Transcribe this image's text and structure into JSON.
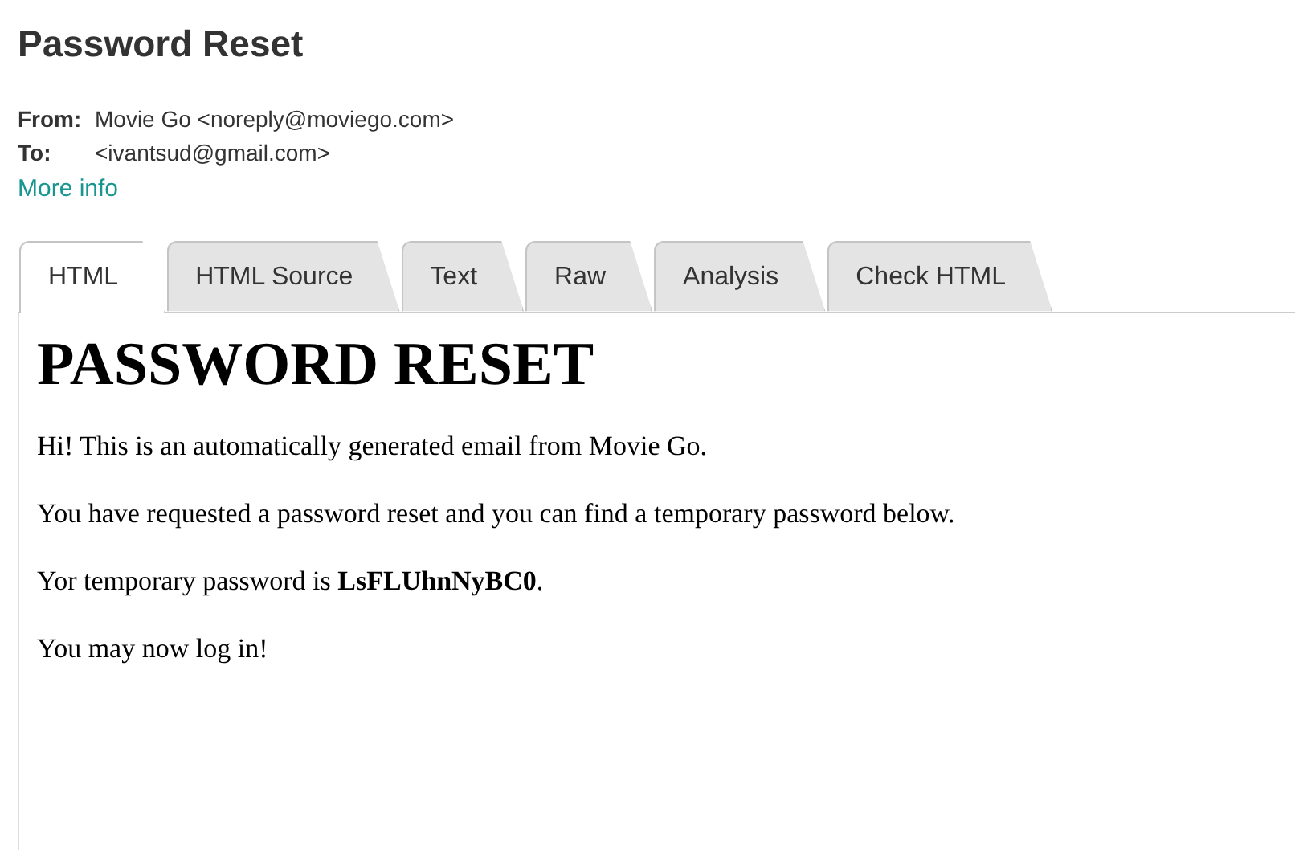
{
  "title": "Password Reset",
  "headers": [
    {
      "label": "From:",
      "value": "Movie Go <noreply@moviego.com>"
    },
    {
      "label": "To:",
      "value": "<ivantsud@gmail.com>"
    }
  ],
  "more_info": "More info",
  "tabs": [
    {
      "label": "HTML",
      "selected": true
    },
    {
      "label": "HTML Source",
      "selected": false
    },
    {
      "label": "Text",
      "selected": false
    },
    {
      "label": "Raw",
      "selected": false
    },
    {
      "label": "Analysis",
      "selected": false
    },
    {
      "label": "Check HTML",
      "selected": false
    }
  ],
  "message": {
    "heading": "PASSWORD RESET",
    "paragraphs": [
      "Hi! This is an automatically generated email from Movie Go.",
      "You have requested a password reset and you can find a temporary password below.",
      "Yor temporary password is **LsFLUhnNyBC0**.",
      "You may now log in!"
    ]
  }
}
